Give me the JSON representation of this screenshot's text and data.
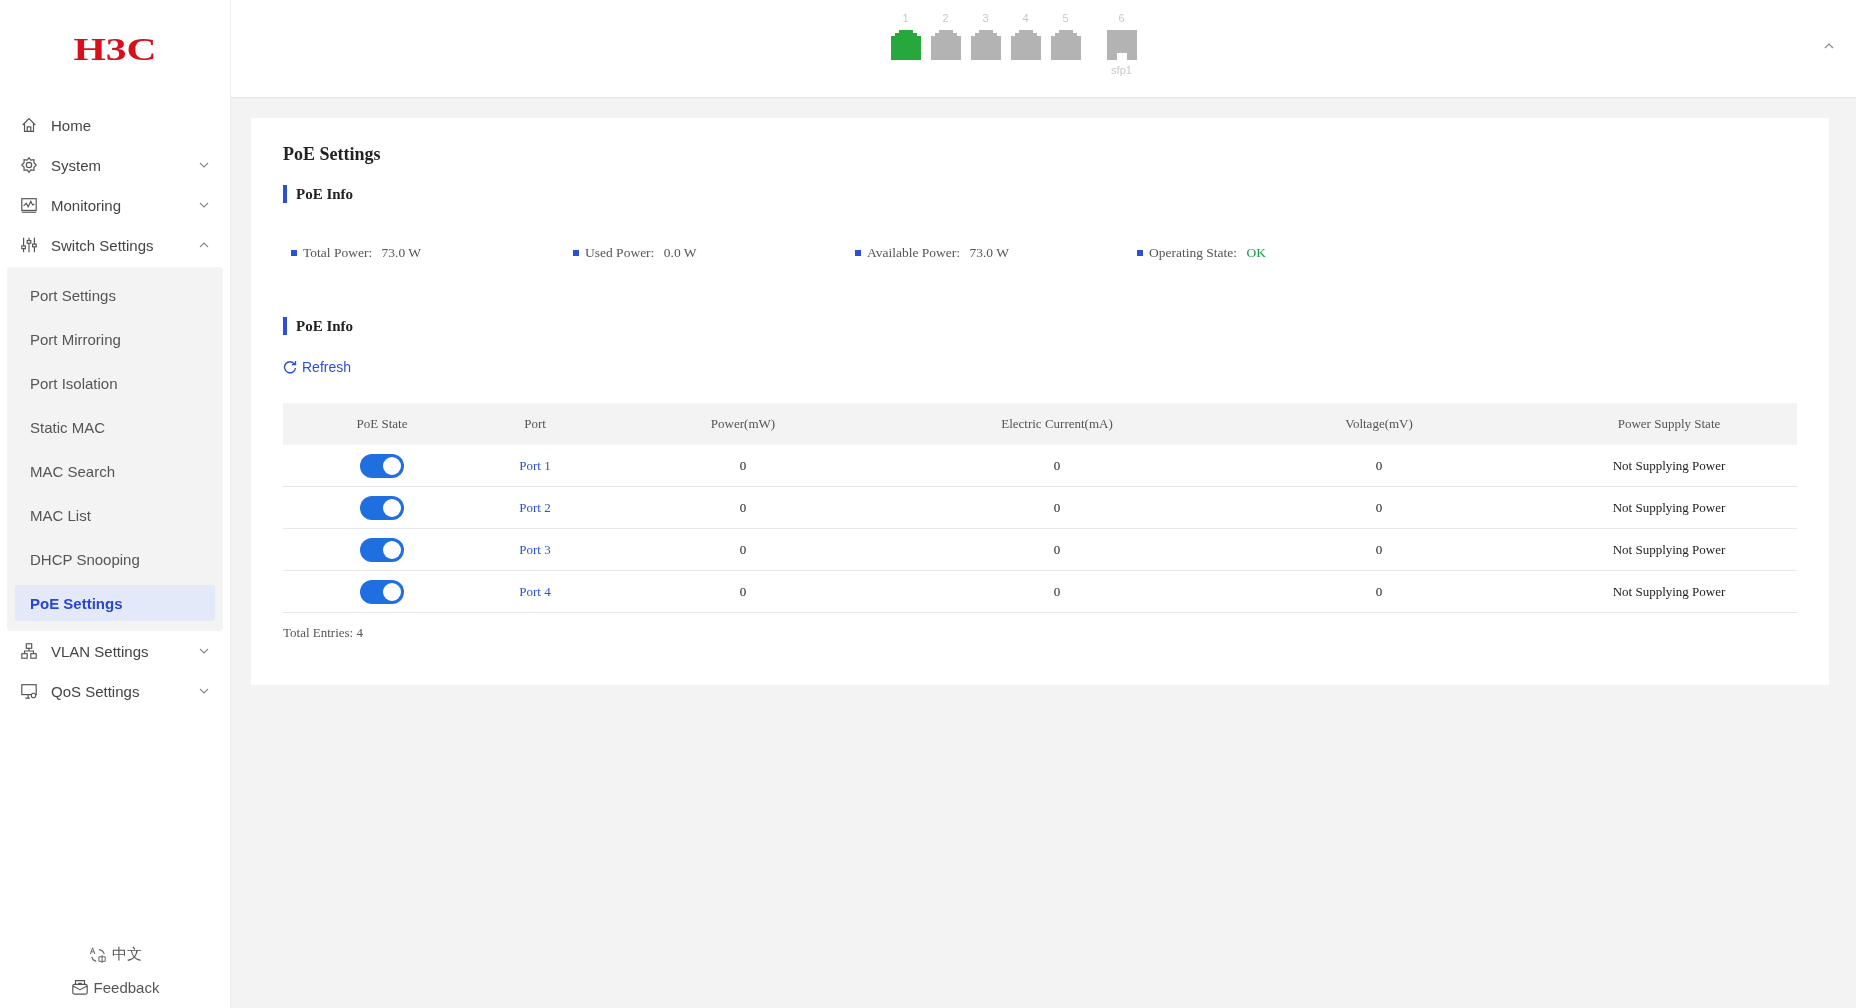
{
  "logo": {
    "text": "H3C"
  },
  "sidebar": {
    "items": [
      {
        "label": "Home",
        "kind": "link"
      },
      {
        "label": "System",
        "kind": "group",
        "expanded": false
      },
      {
        "label": "Monitoring",
        "kind": "group",
        "expanded": false
      },
      {
        "label": "Switch Settings",
        "kind": "group",
        "expanded": true,
        "children": [
          {
            "label": "Port Settings",
            "selected": false
          },
          {
            "label": "Port Mirroring",
            "selected": false
          },
          {
            "label": "Port Isolation",
            "selected": false
          },
          {
            "label": "Static MAC",
            "selected": false
          },
          {
            "label": "MAC Search",
            "selected": false
          },
          {
            "label": "MAC List",
            "selected": false
          },
          {
            "label": "DHCP Snooping",
            "selected": false
          },
          {
            "label": "PoE Settings",
            "selected": true
          }
        ]
      },
      {
        "label": "VLAN Settings",
        "kind": "group",
        "expanded": false
      },
      {
        "label": "QoS Settings",
        "kind": "group",
        "expanded": false
      }
    ],
    "language": "中文",
    "feedback": "Feedback"
  },
  "ports": [
    {
      "number": "1",
      "kind": "rj45",
      "linked": true
    },
    {
      "number": "2",
      "kind": "rj45",
      "linked": false
    },
    {
      "number": "3",
      "kind": "rj45",
      "linked": false
    },
    {
      "number": "4",
      "kind": "rj45",
      "linked": false
    },
    {
      "number": "5",
      "kind": "rj45",
      "linked": false
    },
    {
      "number": "6",
      "kind": "sfp",
      "linked": false,
      "caption": "sfp1"
    }
  ],
  "page": {
    "title": "PoE Settings",
    "info_heading": "PoE Info",
    "stats": [
      {
        "label": "Total Power:",
        "value": "73.0 W",
        "kind": "reading"
      },
      {
        "label": "Used Power:",
        "value": "0.0 W",
        "kind": "reading"
      },
      {
        "label": "Available Power:",
        "value": "73.0 W",
        "kind": "reading"
      },
      {
        "label": "Operating State:",
        "value": "OK",
        "kind": "status"
      }
    ],
    "table_heading": "PoE Info",
    "refresh": "Refresh",
    "table": {
      "columns": [
        "PoE State",
        "Port",
        "Power(mW)",
        "Electric Current(mA)",
        "Voltage(mV)",
        "Power Supply State"
      ],
      "rows": [
        {
          "poe_on": true,
          "port": "Port 1",
          "power": "0",
          "current": "0",
          "voltage": "0",
          "supply_state": "Not Supplying Power"
        },
        {
          "poe_on": true,
          "port": "Port 2",
          "power": "0",
          "current": "0",
          "voltage": "0",
          "supply_state": "Not Supplying Power"
        },
        {
          "poe_on": true,
          "port": "Port 3",
          "power": "0",
          "current": "0",
          "voltage": "0",
          "supply_state": "Not Supplying Power"
        },
        {
          "poe_on": true,
          "port": "Port 4",
          "power": "0",
          "current": "0",
          "voltage": "0",
          "supply_state": "Not Supplying Power"
        }
      ]
    },
    "total": "Total Entries: 4"
  }
}
